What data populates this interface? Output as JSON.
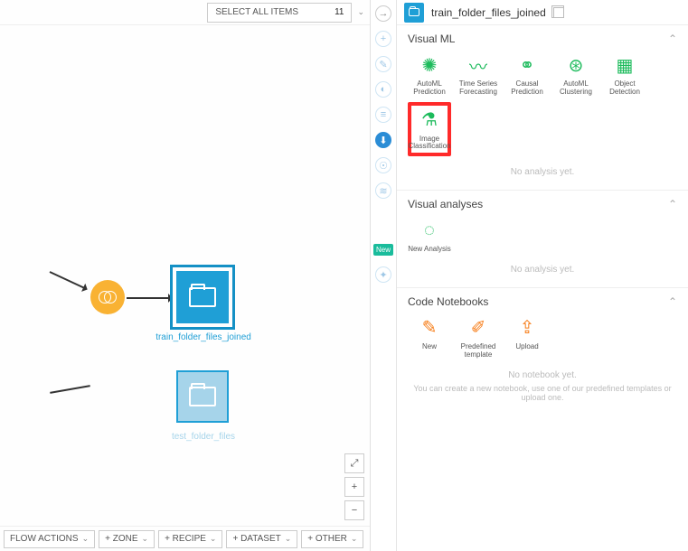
{
  "topbar": {
    "select_all_label": "SELECT ALL ITEMS",
    "select_all_count": "11"
  },
  "flow": {
    "node_train_label": "train_folder_files_joined",
    "node_test_label": "test_folder_files"
  },
  "bottom": {
    "flow_actions": "FLOW ACTIONS",
    "zone": "+ ZONE",
    "recipe": "+ RECIPE",
    "dataset": "+ DATASET",
    "other": "+ OTHER"
  },
  "strip": {
    "new_badge": "New"
  },
  "panel": {
    "title": "train_folder_files_joined",
    "visual_ml": {
      "header": "Visual ML",
      "tiles": [
        {
          "label": "AutoML Prediction"
        },
        {
          "label": "Time Series Forecasting"
        },
        {
          "label": "Causal Prediction"
        },
        {
          "label": "AutoML Clustering"
        },
        {
          "label": "Object Detection"
        },
        {
          "label": "Image Classification"
        }
      ],
      "empty": "No analysis yet."
    },
    "visual_analyses": {
      "header": "Visual analyses",
      "new_label": "New Analysis",
      "empty": "No analysis yet."
    },
    "code_notebooks": {
      "header": "Code Notebooks",
      "tiles_new": "New",
      "tiles_predef": "Predefined template",
      "tiles_upload": "Upload",
      "empty": "No notebook yet.",
      "empty_sub": "You can create a new notebook, use one of our predefined templates or upload one."
    }
  }
}
